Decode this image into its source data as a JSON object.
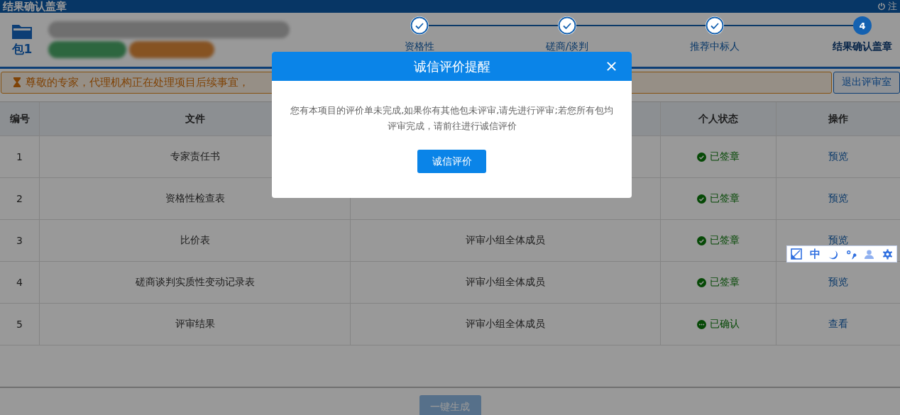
{
  "header": {
    "title": "结果确认盖章",
    "logout": "注"
  },
  "package": {
    "label": "包1"
  },
  "steps": [
    {
      "label": "资格性",
      "done": true
    },
    {
      "label": "磋商/谈判",
      "done": true
    },
    {
      "label": "推荐中标人",
      "done": true
    },
    {
      "label": "结果确认盖章",
      "done": false,
      "number": "4"
    }
  ],
  "notice": {
    "text": "尊敬的专家，代理机构正在处理项目后续事宜，",
    "exit_button": "退出评审室"
  },
  "table": {
    "columns": [
      "编号",
      "文件",
      "个人状态",
      "操作"
    ],
    "rows": [
      {
        "no": "1",
        "file": "专家责任书",
        "status": "已签章",
        "kind": "signed",
        "action": "预览"
      },
      {
        "no": "2",
        "file": "资格性检查表",
        "status": "已签章",
        "kind": "signed",
        "action": "预览"
      },
      {
        "no": "3",
        "file": "比价表",
        "signer": "评审小组全体成员",
        "status": "已签章",
        "kind": "signed",
        "action": "预览"
      },
      {
        "no": "4",
        "file": "磋商谈判实质性变动记录表",
        "signer": "评审小组全体成员",
        "status": "已签章",
        "kind": "signed",
        "action": "预览"
      },
      {
        "no": "5",
        "file": "评审结果",
        "signer": "评审小组全体成员",
        "status": "已确认",
        "kind": "confirmed",
        "action": "查看"
      }
    ]
  },
  "footer": {
    "button": "一键生成"
  },
  "dialog": {
    "title": "诚信评价提醒",
    "message": "您有本项目的评价单未完成,如果你有其他包未评审,请先进行评审;若您所有包均评审完成，请前往进行诚信评价",
    "button": "诚信评价"
  },
  "ime_toolbar": {
    "mode": "中"
  }
}
